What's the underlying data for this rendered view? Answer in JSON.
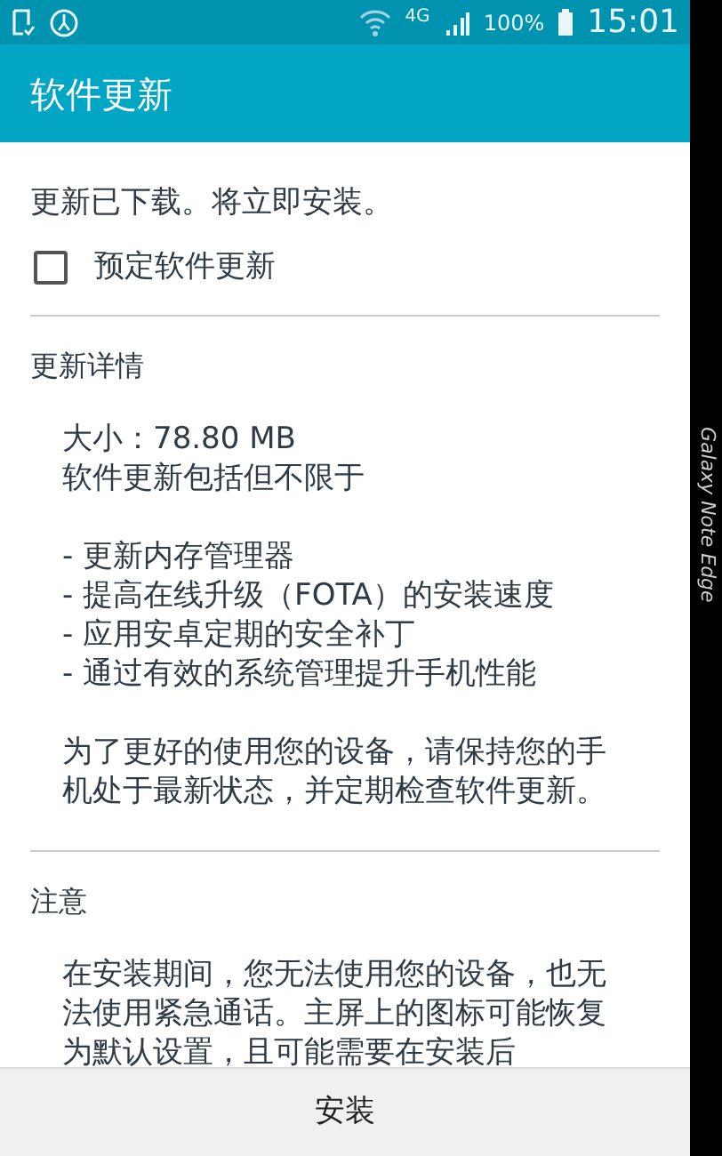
{
  "status_bar": {
    "network": "4G",
    "battery": "100%",
    "time": "15:01"
  },
  "app_bar": {
    "title": "软件更新"
  },
  "message": "更新已下载。将立即安装。",
  "schedule_checkbox": {
    "label": "预定软件更新",
    "checked": false
  },
  "sections": [
    {
      "heading": "更新详情",
      "blocks": [
        [
          "大小：78.80 MB",
          "软件更新包括但不限于"
        ],
        [
          "- 更新内存管理器",
          "- 提高在线升级（FOTA）的安装速度",
          "- 应用安卓定期的安全补丁",
          "- 通过有效的系统管理提升手机性能"
        ],
        [
          "为了更好的使用您的设备，请保持您的手机处于最新状态，并定期检查软件更新。"
        ]
      ]
    },
    {
      "heading": "注意",
      "blocks": [
        [
          "在安装期间，您无法使用您的设备，也无法使用紧急通话。主屏上的图标可能恢复为默认设置，且可能需要在安装后"
        ]
      ]
    }
  ],
  "install_button": "安装",
  "edge_label": "Galaxy Note Edge"
}
